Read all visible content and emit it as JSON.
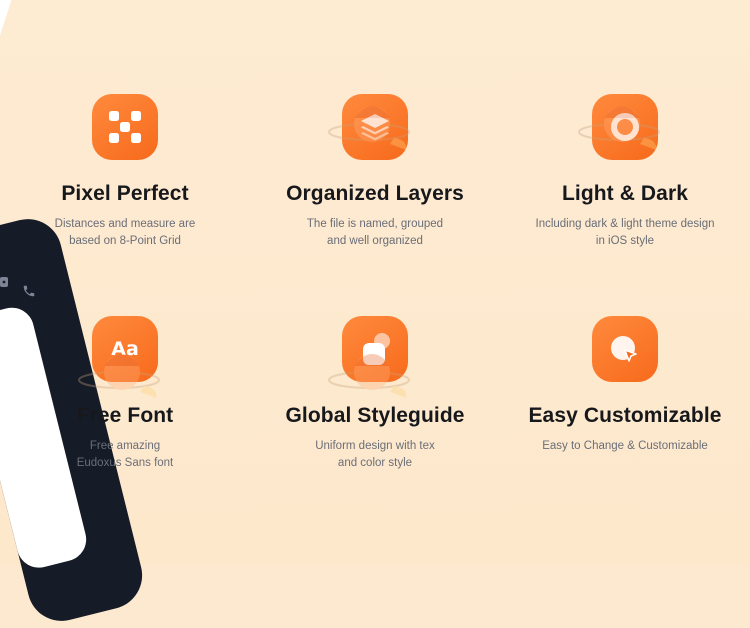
{
  "features": [
    {
      "id": "pixel-perfect",
      "icon": "grid-checker-icon",
      "title": "Pixel Perfect",
      "desc": [
        "Distances and measure are",
        "based on 8-Point Grid"
      ]
    },
    {
      "id": "organized-layers",
      "icon": "layers-icon",
      "title": "Organized Layers",
      "desc": [
        "The file is named, grouped",
        "and well organized"
      ]
    },
    {
      "id": "light-dark",
      "icon": "ring-icon",
      "title": "Light & Dark",
      "desc": [
        "Including dark & light theme design",
        "in iOS style"
      ]
    },
    {
      "id": "free-font",
      "icon": "font-icon",
      "title": "Free Font",
      "glyph": "Aa",
      "desc": [
        "Free amazing",
        "Eudoxus Sans font"
      ]
    },
    {
      "id": "global-styleguide",
      "icon": "styleguide-icon",
      "title": "Global Styleguide",
      "desc": [
        "Uniform design with tex",
        "and color style"
      ]
    },
    {
      "id": "easy-customizable",
      "icon": "cursor-icon",
      "title": "Easy Customizable",
      "desc": [
        "Easy to Change & Customizable"
      ]
    }
  ],
  "colors": {
    "background": "#fde9cf",
    "accent": "#f76a1c",
    "title": "#17181c",
    "desc": "#6a6e78",
    "phone": "#161b28"
  }
}
